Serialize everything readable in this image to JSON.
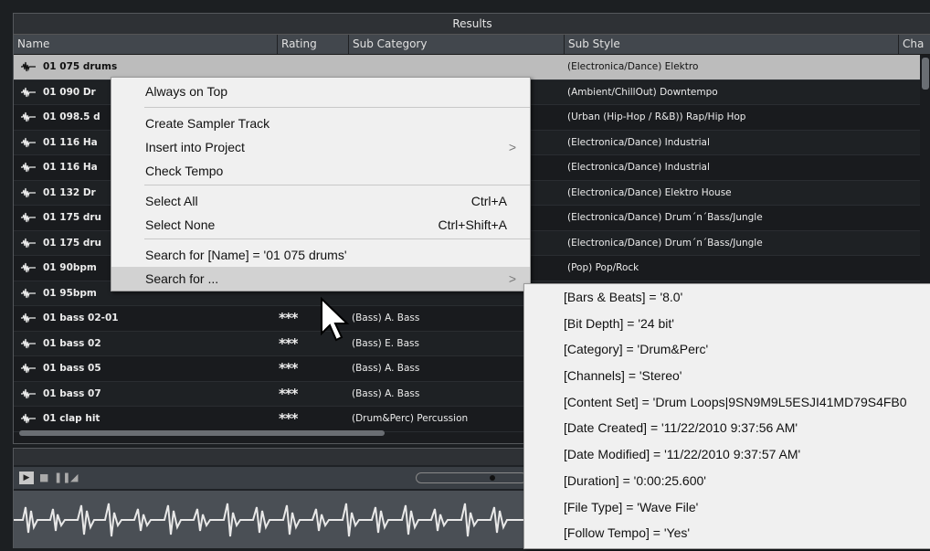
{
  "results_panel": {
    "title": "Results",
    "columns": [
      "Name",
      "Rating",
      "Sub Category",
      "Sub Style",
      "Cha"
    ]
  },
  "rows": [
    {
      "name": "01 075 drums",
      "rating": "",
      "sub_category": "",
      "sub_style": "(Electronica/Dance) Elektro"
    },
    {
      "name": "01 090 Dr",
      "rating": "",
      "sub_category": "",
      "sub_style": "(Ambient/ChillOut) Downtempo"
    },
    {
      "name": "01 098.5 d",
      "rating": "",
      "sub_category": "",
      "sub_style": "(Urban (Hip-Hop / R&B)) Rap/Hip Hop"
    },
    {
      "name": "01 116 Ha",
      "rating": "",
      "sub_category": "",
      "sub_style": "(Electronica/Dance) Industrial"
    },
    {
      "name": "01 116 Ha",
      "rating": "",
      "sub_category": "",
      "sub_style": "(Electronica/Dance) Industrial"
    },
    {
      "name": "01 132 Dr",
      "rating": "",
      "sub_category": "",
      "sub_style": "(Electronica/Dance) Elektro House"
    },
    {
      "name": "01 175 dru",
      "rating": "",
      "sub_category": "",
      "sub_style": "(Electronica/Dance) Drum´n´Bass/Jungle"
    },
    {
      "name": "01 175 dru",
      "rating": "",
      "sub_category": "",
      "sub_style": "(Electronica/Dance) Drum´n´Bass/Jungle"
    },
    {
      "name": "01 90bpm",
      "rating": "",
      "sub_category": "",
      "sub_style": "(Pop) Pop/Rock"
    },
    {
      "name": "01 95bpm",
      "rating": "",
      "sub_category": "",
      "sub_style": ""
    },
    {
      "name": "01 bass 02-01",
      "rating": "***",
      "sub_category": "(Bass) A. Bass",
      "sub_style": ""
    },
    {
      "name": "01 bass 02",
      "rating": "***",
      "sub_category": "(Bass) E. Bass",
      "sub_style": ""
    },
    {
      "name": "01 bass 05",
      "rating": "***",
      "sub_category": "(Bass) A. Bass",
      "sub_style": ""
    },
    {
      "name": "01 bass 07",
      "rating": "***",
      "sub_category": "(Bass) A. Bass",
      "sub_style": ""
    },
    {
      "name": "01 clap hit",
      "rating": "***",
      "sub_category": "(Drum&Perc) Percussion",
      "sub_style": ""
    }
  ],
  "context_menu": {
    "items": [
      {
        "label": "Always on Top",
        "shortcut": "",
        "has_submenu": false
      },
      {
        "label": "Create Sampler Track",
        "shortcut": "",
        "has_submenu": false
      },
      {
        "label": "Insert into Project",
        "shortcut": "",
        "has_submenu": true
      },
      {
        "label": "Check Tempo",
        "shortcut": "",
        "has_submenu": false
      },
      {
        "label": "Select All",
        "shortcut": "Ctrl+A",
        "has_submenu": false
      },
      {
        "label": "Select None",
        "shortcut": "Ctrl+Shift+A",
        "has_submenu": false
      },
      {
        "label": "Search for [Name] = '01 075 drums'",
        "shortcut": "",
        "has_submenu": false
      },
      {
        "label": "Search for ...",
        "shortcut": "",
        "has_submenu": true
      }
    ],
    "submenu_arrow": ">"
  },
  "search_submenu": {
    "items": [
      "[Bars & Beats] = '8.0'",
      "[Bit Depth] = '24 bit'",
      "[Category] = 'Drum&Perc'",
      "[Channels] = 'Stereo'",
      "[Content Set] = 'Drum Loops|9SN9M9L5ESJI41MD79S4FB0",
      "[Date Created] = '11/22/2010 9:37:56 AM'",
      "[Date Modified] = '11/22/2010 9:37:57 AM'",
      "[Duration] = '0:00:25.600'",
      "[File Type] = 'Wave File'",
      "[Follow Tempo] = 'Yes'"
    ]
  },
  "preview": {
    "play_icon": "play-icon",
    "stop_icon": "stop-icon",
    "pause_icon": "pause-icon",
    "metronome_icon": "metronome-icon"
  },
  "colors": {
    "selected_row": "#bcbcbc",
    "menu_bg": "#f0f0f0",
    "menu_highlight": "#d2d2d2",
    "panel_bg": "#1a1c1f"
  }
}
